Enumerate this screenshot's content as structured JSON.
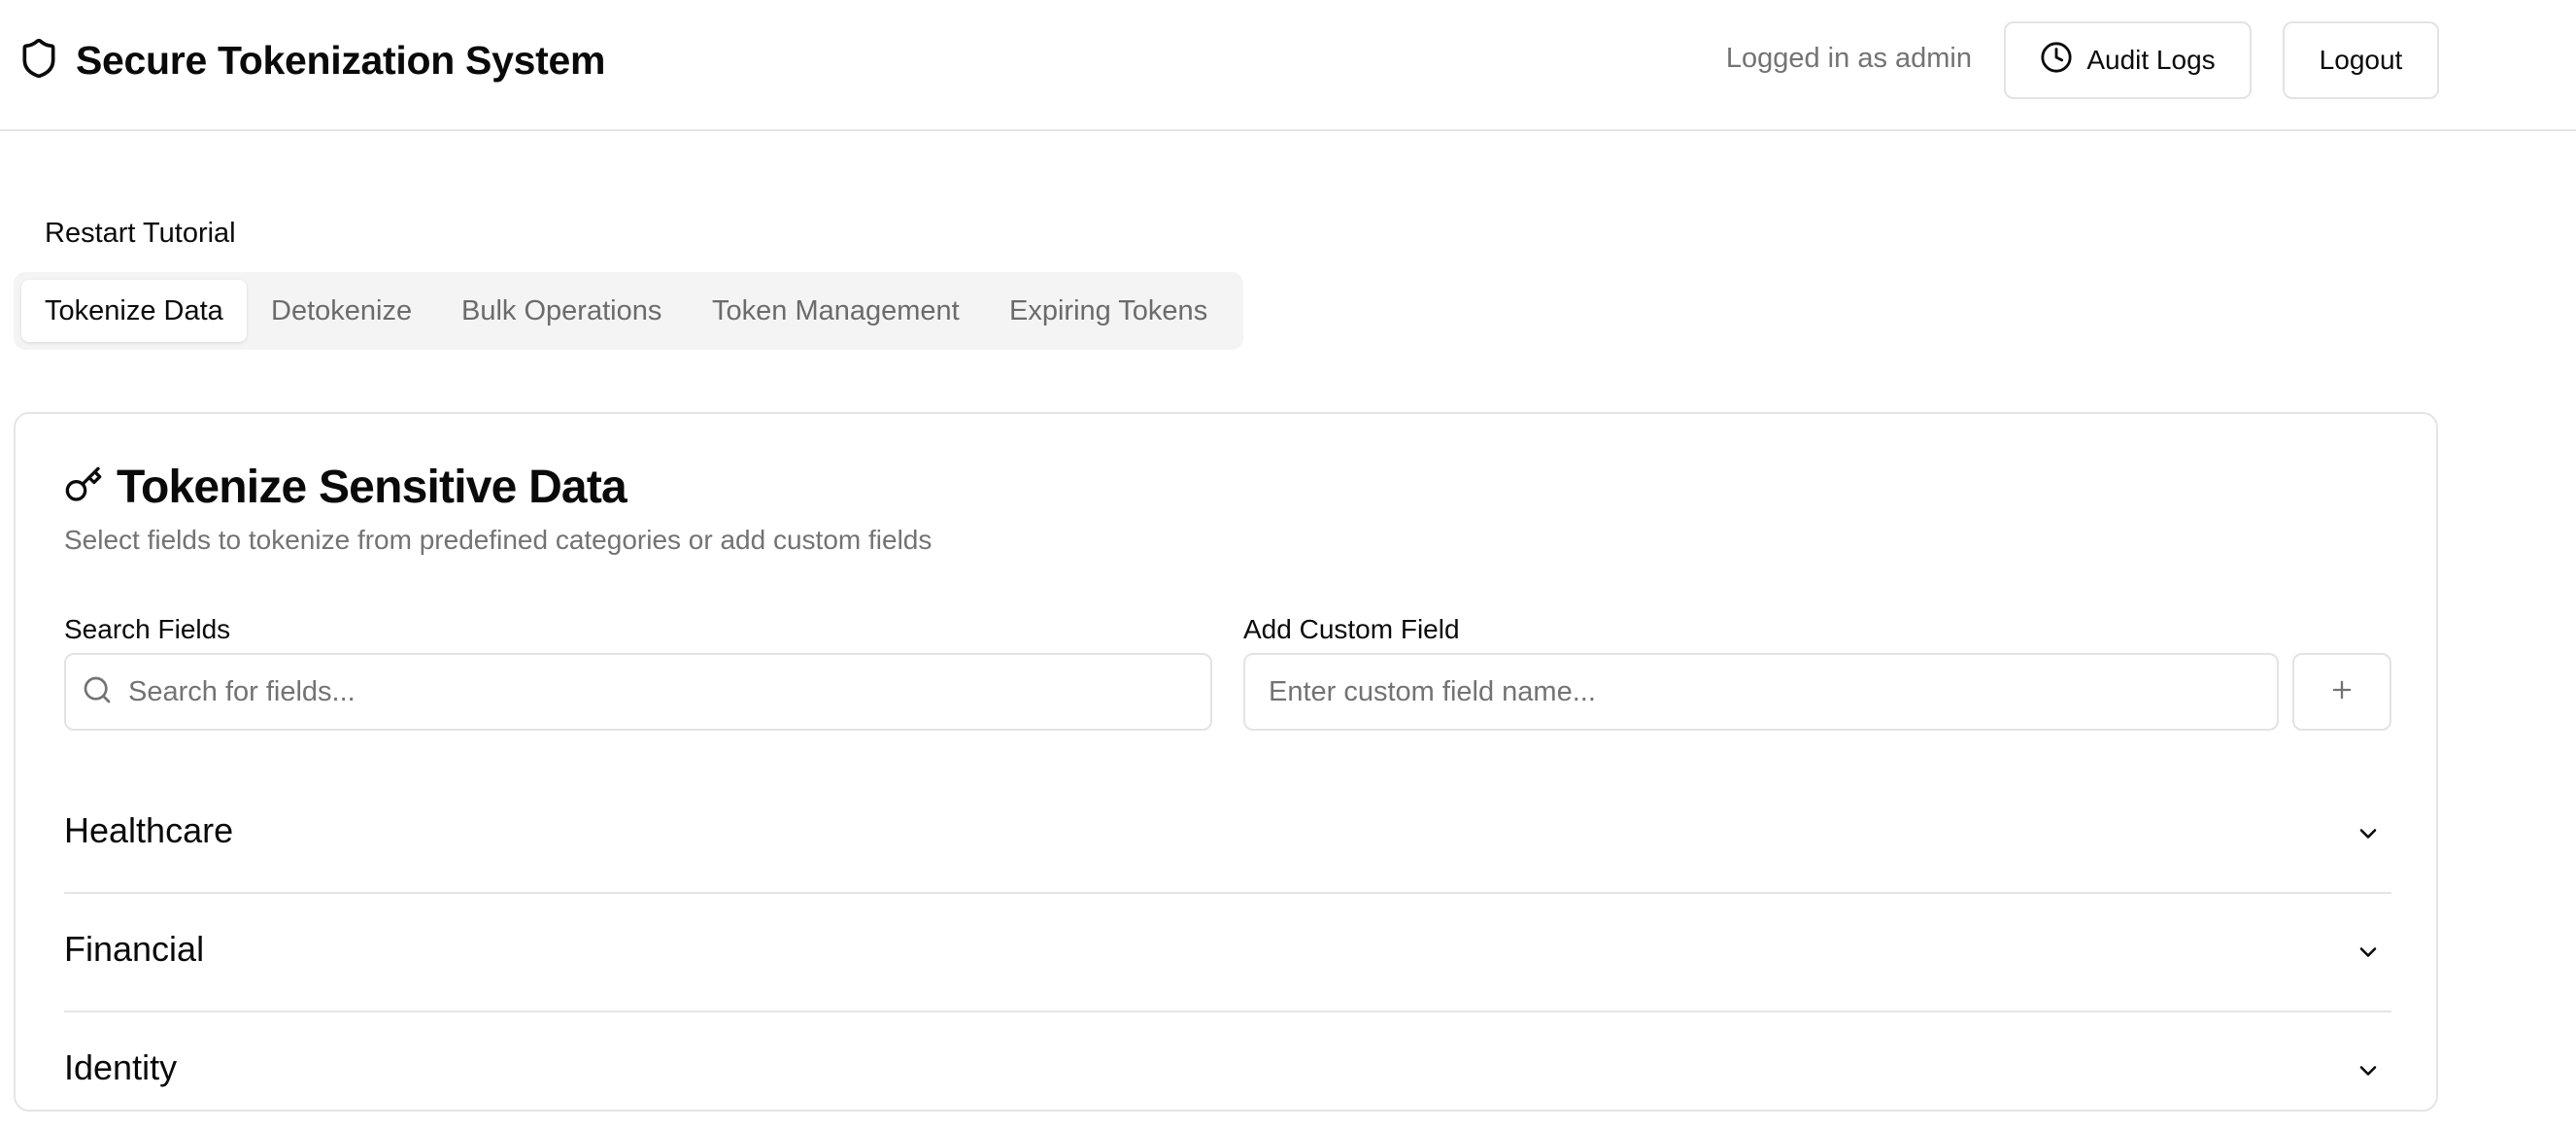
{
  "header": {
    "title": "Secure Tokenization System",
    "logged_in": "Logged in as admin",
    "audit_label": "Audit Logs",
    "logout_label": "Logout"
  },
  "restart_tutorial": "Restart Tutorial",
  "tabs": [
    {
      "label": "Tokenize Data",
      "active": true
    },
    {
      "label": "Detokenize",
      "active": false
    },
    {
      "label": "Bulk Operations",
      "active": false
    },
    {
      "label": "Token Management",
      "active": false
    },
    {
      "label": "Expiring Tokens",
      "active": false
    }
  ],
  "card": {
    "title": "Tokenize Sensitive Data",
    "subtitle": "Select fields to tokenize from predefined categories or add custom fields",
    "search": {
      "label": "Search Fields",
      "placeholder": "Search for fields...",
      "value": ""
    },
    "custom": {
      "label": "Add Custom Field",
      "placeholder": "Enter custom field name...",
      "value": ""
    },
    "categories": [
      {
        "label": "Healthcare",
        "expanded": false
      },
      {
        "label": "Financial",
        "expanded": false
      },
      {
        "label": "Identity",
        "expanded": false
      }
    ]
  },
  "icons": {
    "brand": "shield-icon",
    "audit": "clock-icon",
    "card": "key-icon",
    "search": "search-icon",
    "add": "plus-icon",
    "accordion": "chevron-down-icon"
  },
  "colors": {
    "text": "#0a0a0a",
    "muted": "#737373",
    "border": "#e5e5e5",
    "tab_bg": "#f4f4f5"
  }
}
